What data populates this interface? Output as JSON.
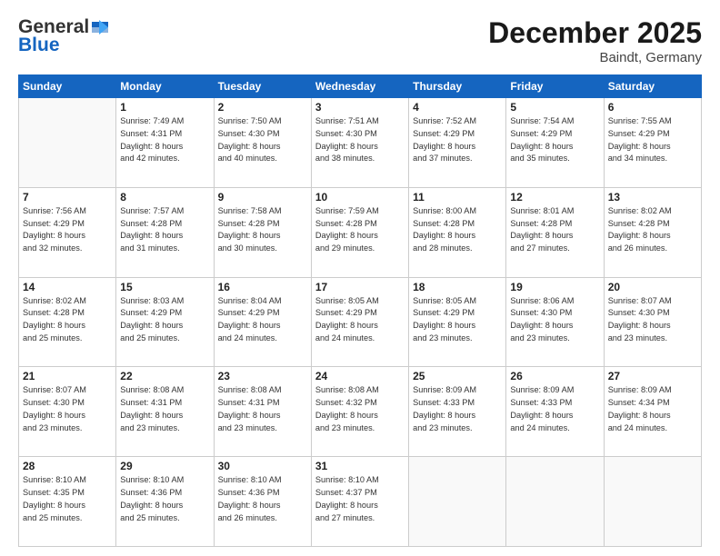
{
  "header": {
    "logo_general": "General",
    "logo_blue": "Blue",
    "month": "December 2025",
    "location": "Baindt, Germany"
  },
  "weekdays": [
    "Sunday",
    "Monday",
    "Tuesday",
    "Wednesday",
    "Thursday",
    "Friday",
    "Saturday"
  ],
  "weeks": [
    [
      {
        "day": "",
        "info": ""
      },
      {
        "day": "1",
        "info": "Sunrise: 7:49 AM\nSunset: 4:31 PM\nDaylight: 8 hours\nand 42 minutes."
      },
      {
        "day": "2",
        "info": "Sunrise: 7:50 AM\nSunset: 4:30 PM\nDaylight: 8 hours\nand 40 minutes."
      },
      {
        "day": "3",
        "info": "Sunrise: 7:51 AM\nSunset: 4:30 PM\nDaylight: 8 hours\nand 38 minutes."
      },
      {
        "day": "4",
        "info": "Sunrise: 7:52 AM\nSunset: 4:29 PM\nDaylight: 8 hours\nand 37 minutes."
      },
      {
        "day": "5",
        "info": "Sunrise: 7:54 AM\nSunset: 4:29 PM\nDaylight: 8 hours\nand 35 minutes."
      },
      {
        "day": "6",
        "info": "Sunrise: 7:55 AM\nSunset: 4:29 PM\nDaylight: 8 hours\nand 34 minutes."
      }
    ],
    [
      {
        "day": "7",
        "info": "Sunrise: 7:56 AM\nSunset: 4:29 PM\nDaylight: 8 hours\nand 32 minutes."
      },
      {
        "day": "8",
        "info": "Sunrise: 7:57 AM\nSunset: 4:28 PM\nDaylight: 8 hours\nand 31 minutes."
      },
      {
        "day": "9",
        "info": "Sunrise: 7:58 AM\nSunset: 4:28 PM\nDaylight: 8 hours\nand 30 minutes."
      },
      {
        "day": "10",
        "info": "Sunrise: 7:59 AM\nSunset: 4:28 PM\nDaylight: 8 hours\nand 29 minutes."
      },
      {
        "day": "11",
        "info": "Sunrise: 8:00 AM\nSunset: 4:28 PM\nDaylight: 8 hours\nand 28 minutes."
      },
      {
        "day": "12",
        "info": "Sunrise: 8:01 AM\nSunset: 4:28 PM\nDaylight: 8 hours\nand 27 minutes."
      },
      {
        "day": "13",
        "info": "Sunrise: 8:02 AM\nSunset: 4:28 PM\nDaylight: 8 hours\nand 26 minutes."
      }
    ],
    [
      {
        "day": "14",
        "info": "Sunrise: 8:02 AM\nSunset: 4:28 PM\nDaylight: 8 hours\nand 25 minutes."
      },
      {
        "day": "15",
        "info": "Sunrise: 8:03 AM\nSunset: 4:29 PM\nDaylight: 8 hours\nand 25 minutes."
      },
      {
        "day": "16",
        "info": "Sunrise: 8:04 AM\nSunset: 4:29 PM\nDaylight: 8 hours\nand 24 minutes."
      },
      {
        "day": "17",
        "info": "Sunrise: 8:05 AM\nSunset: 4:29 PM\nDaylight: 8 hours\nand 24 minutes."
      },
      {
        "day": "18",
        "info": "Sunrise: 8:05 AM\nSunset: 4:29 PM\nDaylight: 8 hours\nand 23 minutes."
      },
      {
        "day": "19",
        "info": "Sunrise: 8:06 AM\nSunset: 4:30 PM\nDaylight: 8 hours\nand 23 minutes."
      },
      {
        "day": "20",
        "info": "Sunrise: 8:07 AM\nSunset: 4:30 PM\nDaylight: 8 hours\nand 23 minutes."
      }
    ],
    [
      {
        "day": "21",
        "info": "Sunrise: 8:07 AM\nSunset: 4:30 PM\nDaylight: 8 hours\nand 23 minutes."
      },
      {
        "day": "22",
        "info": "Sunrise: 8:08 AM\nSunset: 4:31 PM\nDaylight: 8 hours\nand 23 minutes."
      },
      {
        "day": "23",
        "info": "Sunrise: 8:08 AM\nSunset: 4:31 PM\nDaylight: 8 hours\nand 23 minutes."
      },
      {
        "day": "24",
        "info": "Sunrise: 8:08 AM\nSunset: 4:32 PM\nDaylight: 8 hours\nand 23 minutes."
      },
      {
        "day": "25",
        "info": "Sunrise: 8:09 AM\nSunset: 4:33 PM\nDaylight: 8 hours\nand 23 minutes."
      },
      {
        "day": "26",
        "info": "Sunrise: 8:09 AM\nSunset: 4:33 PM\nDaylight: 8 hours\nand 24 minutes."
      },
      {
        "day": "27",
        "info": "Sunrise: 8:09 AM\nSunset: 4:34 PM\nDaylight: 8 hours\nand 24 minutes."
      }
    ],
    [
      {
        "day": "28",
        "info": "Sunrise: 8:10 AM\nSunset: 4:35 PM\nDaylight: 8 hours\nand 25 minutes."
      },
      {
        "day": "29",
        "info": "Sunrise: 8:10 AM\nSunset: 4:36 PM\nDaylight: 8 hours\nand 25 minutes."
      },
      {
        "day": "30",
        "info": "Sunrise: 8:10 AM\nSunset: 4:36 PM\nDaylight: 8 hours\nand 26 minutes."
      },
      {
        "day": "31",
        "info": "Sunrise: 8:10 AM\nSunset: 4:37 PM\nDaylight: 8 hours\nand 27 minutes."
      },
      {
        "day": "",
        "info": ""
      },
      {
        "day": "",
        "info": ""
      },
      {
        "day": "",
        "info": ""
      }
    ]
  ]
}
